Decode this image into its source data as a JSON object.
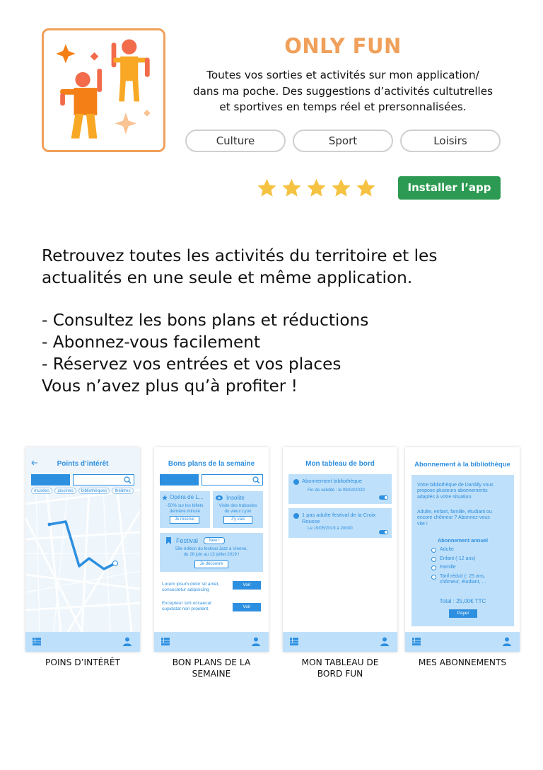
{
  "app": {
    "title": "ONLY FUN",
    "description_lines": [
      "Toutes vos sorties et activités sur mon application/",
      "dans ma poche. Des suggestions d’activités cultutrelles",
      "et sportives en temps réel et prersonnalisées."
    ],
    "tags": [
      "Culture",
      "Sport",
      "Loisirs"
    ],
    "rating": 5,
    "rating_max": 5,
    "install_label": "Installer l’app",
    "icon": "dancing-people-icon"
  },
  "lead_lines": [
    "Retrouvez toutes les activités du territoire et les",
    "actualités en une seule et même application."
  ],
  "features": [
    "- Consultez les bons plans et réductions",
    "- Abonnez-vous facilement",
    "- Réservez vos entrées et vos places",
    "Vous n’avez plus qu’à profiter !"
  ],
  "colors": {
    "brand_orange": "#f0a05a",
    "install_green": "#2c9a52",
    "mock_blue": "#2d8fe0",
    "mock_light_blue": "#bfe0fa",
    "star_yellow": "#f5c242"
  },
  "screens": [
    {
      "title": "Points d’intérêt",
      "caption_lines": [
        "POINS D’INTÉRÊT"
      ],
      "chips": [
        "musées",
        "piscines",
        "bibliothèques",
        "théâtres"
      ]
    },
    {
      "title": "Bons plans de la semaine",
      "caption_lines": [
        "BON PLANS DE LA",
        "SEMAINE"
      ],
      "card1": {
        "title": "Opéra de L...",
        "text_lines": [
          "-50% sur les billets",
          "dernière minute"
        ],
        "button": "Je réserve"
      },
      "card2": {
        "title": "Insolite",
        "text_lines": [
          "Visite des traboules",
          "du vieux Lyon"
        ],
        "button": "J’y vais"
      },
      "card3": {
        "title": "Festival",
        "badge": "New !",
        "text_lines": [
          "59e édition du festival Jazz à Vienne,",
          "du 28 juin au 13 juillet 2019 !"
        ],
        "button": "Je découvre"
      },
      "list": [
        {
          "lines": [
            "Lorem ipsum dolor sit amet,",
            "consectetur adipisicing"
          ],
          "button": "Voir"
        },
        {
          "lines": [
            "Excepteur sint occaecat",
            "cupidatat non proident."
          ],
          "button": "Voir"
        }
      ]
    },
    {
      "title": "Mon tableau de bord",
      "caption_lines": [
        "MON TABLEAU DE",
        "BORD FUN"
      ],
      "items": [
        {
          "title_lines": [
            "Abonnement bibliothèque"
          ],
          "sub": "Fin de validité : le 09/04/2020"
        },
        {
          "title_lines": [
            "1 pas adulte festival de la Croix",
            "Rousse"
          ],
          "sub": "Le 19/05/2019 à 20h30"
        }
      ]
    },
    {
      "title": "Abonnement à la bibliothèque",
      "caption_lines": [
        "MES ABONNEMENTS"
      ],
      "intro_lines": [
        "Votre bibliothèque de Dardilly vous",
        "propose plusieurs abonnements",
        "adaptés à votre situation."
      ],
      "question_lines": [
        "Adulte, enfant, famille, étudiant ou",
        "encore chômeur ? Abonnez-vous",
        "vite !"
      ],
      "section_title": "Abonnement annuel",
      "options": [
        {
          "lines": [
            "Adulte"
          ]
        },
        {
          "lines": [
            "Enfant (-12 ans)"
          ]
        },
        {
          "lines": [
            "Famille"
          ]
        },
        {
          "lines": [
            "Tarif réduit (- 25 ans,",
            "chômeur, étudiant, ..."
          ]
        }
      ],
      "total": "Total : 25,00€ TTC",
      "pay_button": "Payer"
    }
  ]
}
